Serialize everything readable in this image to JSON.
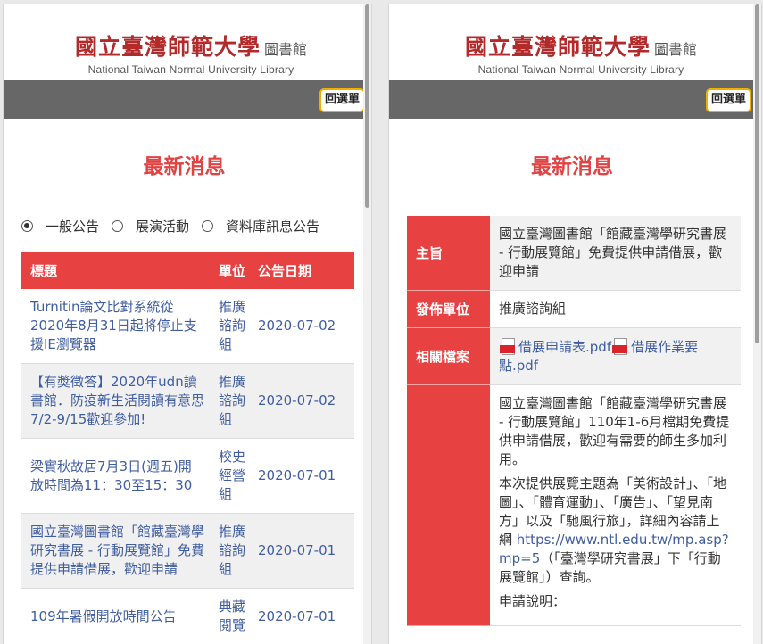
{
  "logo": {
    "chinese": "國立臺灣師範大學",
    "library": "圖書館",
    "english": "National Taiwan Normal University Library"
  },
  "menu_button": "回選單",
  "heading": "最新消息",
  "filters": [
    {
      "label": "一般公告",
      "checked": true
    },
    {
      "label": "展演活動",
      "checked": false
    },
    {
      "label": "資料庫訊息公告",
      "checked": false
    }
  ],
  "table": {
    "headers": {
      "title": "標題",
      "unit": "單位",
      "date": "公告日期"
    },
    "rows": [
      {
        "title": "Turnitin論文比對系統從2020年8月31日起將停止支援IE瀏覽器",
        "unit": "推廣諮詢組",
        "date": "2020-07-02"
      },
      {
        "title": "【有獎徵答】2020年udn讀書館．防疫新生活閱讀有意思7/2-9/15歡迎參加!",
        "unit": "推廣諮詢組",
        "date": "2020-07-02"
      },
      {
        "title": "梁實秋故居7月3日(週五)開放時間為11：30至15：30",
        "unit": "校史經營組",
        "date": "2020-07-01"
      },
      {
        "title": "國立臺灣圖書館「館藏臺灣學研究書展 - 行動展覽館」免費提供申請借展，歡迎申請",
        "unit": "推廣諮詢組",
        "date": "2020-07-01"
      },
      {
        "title": "109年暑假開放時間公告",
        "unit": "典藏閱覽",
        "date": "2020-07-01"
      }
    ]
  },
  "detail": {
    "labels": {
      "subject": "主旨",
      "unit": "發佈單位",
      "files": "相關檔案"
    },
    "subject": "國立臺灣圖書館「館藏臺灣學研究書展 - 行動展覽館」免費提供申請借展，歡迎申請",
    "unit": "推廣諮詢組",
    "files": [
      "借展申請表.pdf",
      "借展作業要點.pdf"
    ],
    "body": {
      "p1": "國立臺灣圖書館「館藏臺灣學研究書展 - 行動展覽館」110年1-6月檔期免費提供申請借展，歡迎有需要的師生多加利用。",
      "p2_a": "本次提供展覽主題為「美術設計」、「地圖」、「體育運動」、「廣告」、「望見南方」以及「馳風行旅」，詳細內容請上網",
      "p2_url": "https://www.ntl.edu.tw/mp.asp?mp=5",
      "p2_b": "（「臺灣學研究書展」下「行動展覽館」）查詢。",
      "p3": "申請說明："
    }
  }
}
